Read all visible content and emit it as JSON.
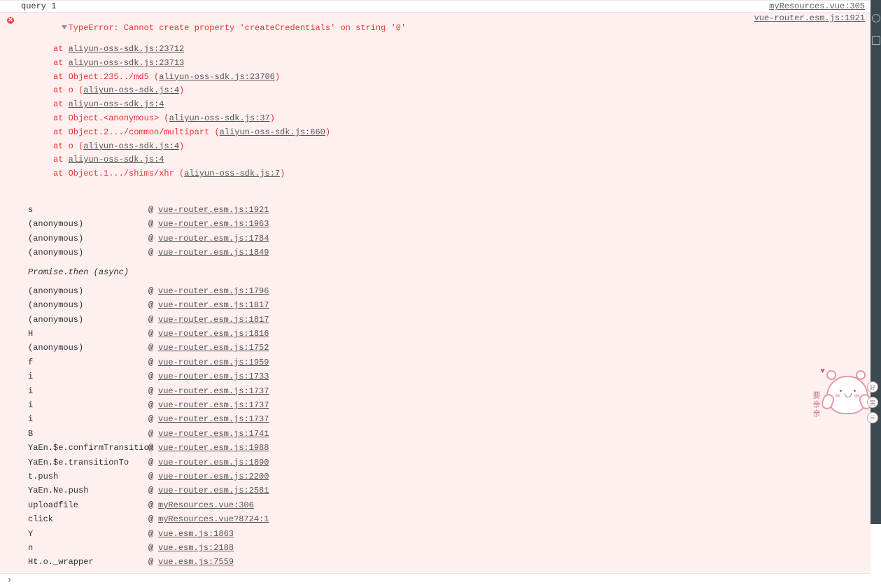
{
  "query": {
    "label": "query",
    "num": "1",
    "location": "myResources.vue:305"
  },
  "error": {
    "message": "TypeError: Cannot create property 'createCredentials' on string '0'",
    "location": "vue-router.esm.js:1921",
    "stack": [
      {
        "prefix": "at ",
        "link": "aliyun-oss-sdk.js:23712",
        "suffix": ""
      },
      {
        "prefix": "at ",
        "link": "aliyun-oss-sdk.js:23713",
        "suffix": ""
      },
      {
        "prefix": "at Object.235../md5 (",
        "link": "aliyun-oss-sdk.js:23706",
        "suffix": ")"
      },
      {
        "prefix": "at o (",
        "link": "aliyun-oss-sdk.js:4",
        "suffix": ")"
      },
      {
        "prefix": "at ",
        "link": "aliyun-oss-sdk.js:4",
        "suffix": ""
      },
      {
        "prefix": "at Object.<anonymous> (",
        "link": "aliyun-oss-sdk.js:37",
        "suffix": ")"
      },
      {
        "prefix": "at Object.2.../common/multipart (",
        "link": "aliyun-oss-sdk.js:660",
        "suffix": ")"
      },
      {
        "prefix": "at o (",
        "link": "aliyun-oss-sdk.js:4",
        "suffix": ")"
      },
      {
        "prefix": "at ",
        "link": "aliyun-oss-sdk.js:4",
        "suffix": ""
      },
      {
        "prefix": "at Object.1.../shims/xhr (",
        "link": "aliyun-oss-sdk.js:7",
        "suffix": ")"
      }
    ],
    "calls_pre": [
      {
        "fn": "s",
        "loc": "vue-router.esm.js:1921"
      },
      {
        "fn": "(anonymous)",
        "loc": "vue-router.esm.js:1963"
      },
      {
        "fn": "(anonymous)",
        "loc": "vue-router.esm.js:1784"
      },
      {
        "fn": "(anonymous)",
        "loc": "vue-router.esm.js:1849"
      }
    ],
    "async_label": "Promise.then (async)",
    "calls_post": [
      {
        "fn": "(anonymous)",
        "loc": "vue-router.esm.js:1796"
      },
      {
        "fn": "(anonymous)",
        "loc": "vue-router.esm.js:1817"
      },
      {
        "fn": "(anonymous)",
        "loc": "vue-router.esm.js:1817"
      },
      {
        "fn": "H",
        "loc": "vue-router.esm.js:1816"
      },
      {
        "fn": "(anonymous)",
        "loc": "vue-router.esm.js:1752"
      },
      {
        "fn": "f",
        "loc": "vue-router.esm.js:1959"
      },
      {
        "fn": "i",
        "loc": "vue-router.esm.js:1733"
      },
      {
        "fn": "i",
        "loc": "vue-router.esm.js:1737"
      },
      {
        "fn": "i",
        "loc": "vue-router.esm.js:1737"
      },
      {
        "fn": "i",
        "loc": "vue-router.esm.js:1737"
      },
      {
        "fn": "B",
        "loc": "vue-router.esm.js:1741"
      },
      {
        "fn": "YaEn.$e.confirmTransition",
        "loc": "vue-router.esm.js:1988"
      },
      {
        "fn": "YaEn.$e.transitionTo",
        "loc": "vue-router.esm.js:1890"
      },
      {
        "fn": "t.push",
        "loc": "vue-router.esm.js:2200"
      },
      {
        "fn": "YaEn.Ne.push",
        "loc": "vue-router.esm.js:2581"
      },
      {
        "fn": "uploadfile",
        "loc": "myResources.vue:306"
      },
      {
        "fn": "click",
        "loc": "myResources.vue?8724:1"
      },
      {
        "fn": "Y",
        "loc": "vue.esm.js:1863"
      },
      {
        "fn": "n",
        "loc": "vue.esm.js:2188"
      },
      {
        "fn": "Ht.o._wrapper",
        "loc": "vue.esm.js:7559"
      }
    ]
  },
  "prompt": "›",
  "sticker": {
    "text": "要亲亲",
    "b1": "好",
    "b2": "笑",
    "b3": "ⓜ"
  }
}
